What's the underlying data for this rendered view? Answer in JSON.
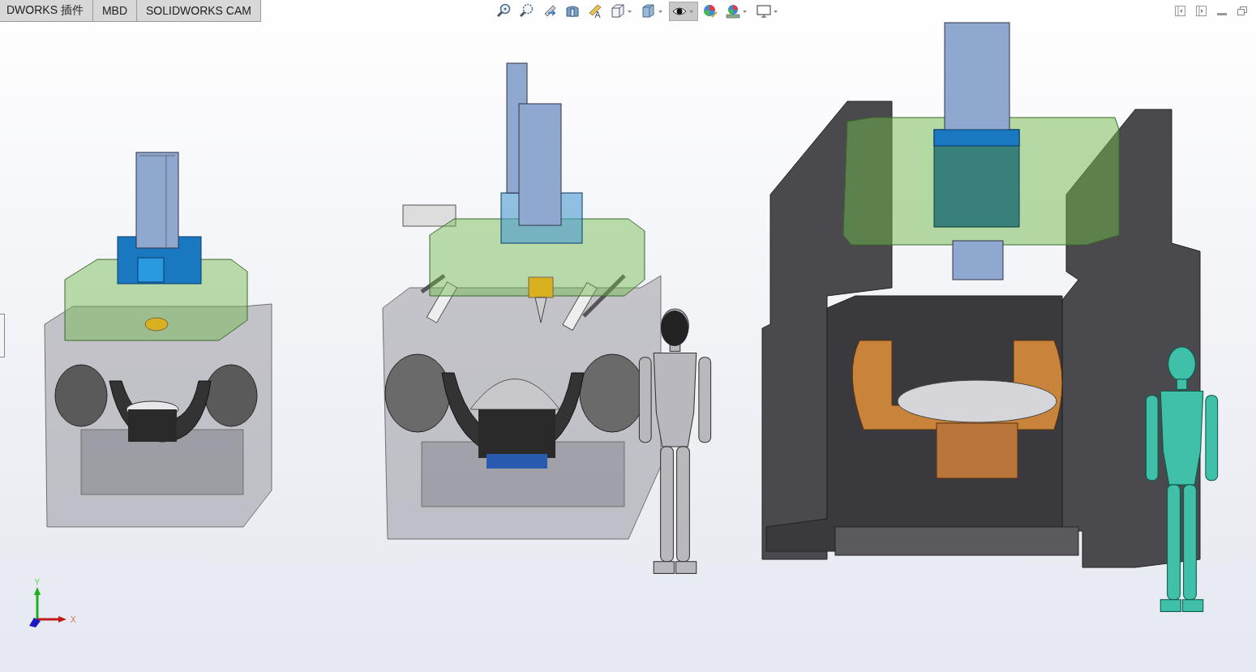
{
  "command_tabs": [
    {
      "label": "DWORKS 插件",
      "selected": false
    },
    {
      "label": "MBD",
      "selected": false
    },
    {
      "label": "SOLIDWORKS CAM",
      "selected": false
    }
  ],
  "heads_up_toolbar": [
    {
      "kind": "zoom-fit",
      "dropdown": false,
      "on": false
    },
    {
      "kind": "zoom-area",
      "dropdown": false,
      "on": false
    },
    {
      "kind": "previous-view",
      "dropdown": false,
      "on": false
    },
    {
      "kind": "section-view",
      "dropdown": false,
      "on": false
    },
    {
      "kind": "annotation-view",
      "dropdown": false,
      "on": false
    },
    {
      "kind": "view-orientation",
      "dropdown": true,
      "on": false
    },
    {
      "kind": "display-style",
      "dropdown": true,
      "on": false
    },
    {
      "kind": "hide-show",
      "dropdown": true,
      "on": true
    },
    {
      "kind": "edit-appearance",
      "dropdown": false,
      "on": false
    },
    {
      "kind": "apply-scene",
      "dropdown": true,
      "on": false
    },
    {
      "kind": "view-settings",
      "dropdown": true,
      "on": false
    }
  ],
  "triad": {
    "x_label": "X",
    "y_label": "Y"
  }
}
